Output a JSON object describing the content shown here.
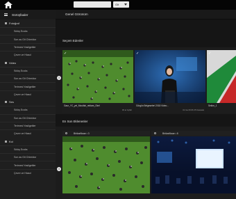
{
  "topbar": {
    "go_label": "Git"
  },
  "sidebar": {
    "title": "Sürüşfaaler",
    "sections": [
      {
        "label": "Fotoğraf",
        "items": [
          "Sıkkş Ecoks",
          "Son as Git Chimidor",
          "Terimesl Yasligetiler",
          "Çevre ve Hiasd"
        ]
      },
      {
        "label": "Video",
        "items": [
          "Sıkkş Ecoks",
          "Son as Git Chimidor",
          "Terimesl Yasligetiler",
          "Çevre ve Hiasd"
        ]
      },
      {
        "label": "Ses",
        "items": [
          "Sıkkş Ecoks",
          "Son as Git Chimidor",
          "Terimesl Yasligetiler",
          "Çevre ve Hiasd"
        ]
      },
      {
        "label": "Kol",
        "items": [
          "Sıkkş Ecoks",
          "Son as Git Chimidor",
          "Terimesl Yasligetiler",
          "Çevre ve Hiasd"
        ]
      }
    ]
  },
  "main": {
    "header": "Genel Görünüm",
    "section1_title": "Seçem Edenler",
    "section2_title": "En Son Eklenenler",
    "row1": [
      {
        "title": "Gaur_YC_yel_Mouitlut_reklam_Okel",
        "date": "30 ar Ayfah"
      },
      {
        "title": "Görgün Belgeseleri 2018 Video...",
        "date": "01 Ga 09:06 25 Kasasak"
      },
      {
        "title": "Sekim_1",
        "date": ""
      }
    ],
    "row2": [
      {
        "title": "Birikarlikaar • 3"
      },
      {
        "title": "Birikarlikaar • 8"
      }
    ]
  }
}
